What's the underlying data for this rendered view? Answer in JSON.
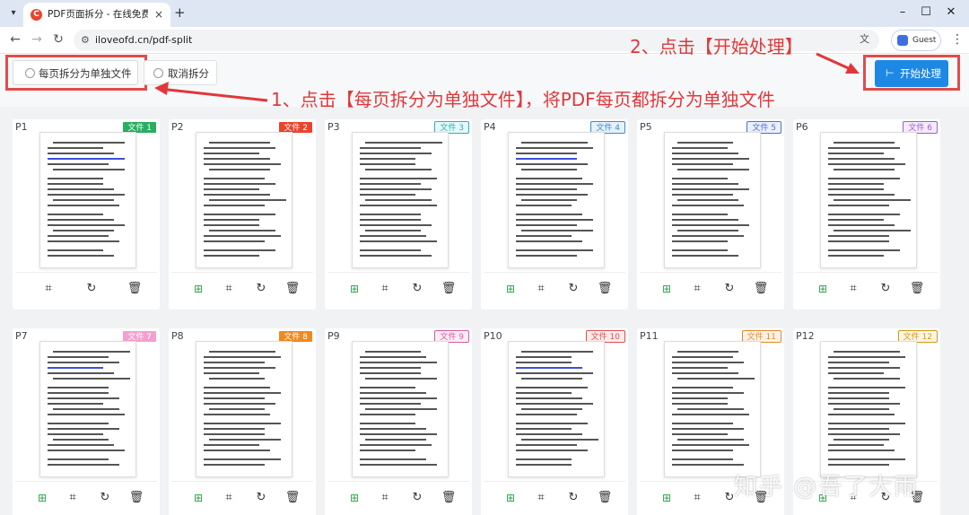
{
  "browser": {
    "tab_title": "PDF页面拆分 - 在线免费拆分PDF",
    "url": "iloveofd.cn/pdf-split",
    "profile_label": "Guest",
    "menu_glyph": "▾",
    "new_tab_glyph": "+",
    "close_glyph": "×"
  },
  "toolbar": {
    "each_page_label": "每页拆分为单独文件",
    "cancel_label": "取消拆分",
    "start_label": "开始处理"
  },
  "annotations": {
    "step1": "1、点击【每页拆分为单独文件】，将PDF每页都拆分为单独文件",
    "step2": "2、点击【开始处理】"
  },
  "pages": [
    {
      "label": "P1",
      "file": "文件 1",
      "badge_bg": "#27ae60",
      "badge_fg": "#ffffff"
    },
    {
      "label": "P2",
      "file": "文件 2",
      "badge_bg": "#e8442e",
      "badge_fg": "#ffffff"
    },
    {
      "label": "P3",
      "file": "文件 3",
      "badge_bg": "#e6f8f8",
      "badge_fg": "#2ab3b3"
    },
    {
      "label": "P4",
      "file": "文件 4",
      "badge_bg": "#e6f1fc",
      "badge_fg": "#3b8ad9"
    },
    {
      "label": "P5",
      "file": "文件 5",
      "badge_bg": "#eaf0fd",
      "badge_fg": "#4d6fe0"
    },
    {
      "label": "P6",
      "file": "文件 6",
      "badge_bg": "#f4ebfb",
      "badge_fg": "#a05cd6"
    },
    {
      "label": "P7",
      "file": "文件 7",
      "badge_bg": "#f59fd0",
      "badge_fg": "#ffffff"
    },
    {
      "label": "P8",
      "file": "文件 8",
      "badge_bg": "#f08a1c",
      "badge_fg": "#ffffff"
    },
    {
      "label": "P9",
      "file": "文件 9",
      "badge_bg": "#fdeef6",
      "badge_fg": "#d65aa0"
    },
    {
      "label": "P10",
      "file": "文件 10",
      "badge_bg": "#fdecec",
      "badge_fg": "#d85050"
    },
    {
      "label": "P11",
      "file": "文件 11",
      "badge_bg": "#fdf2e6",
      "badge_fg": "#e08a2a"
    },
    {
      "label": "P12",
      "file": "文件 12",
      "badge_bg": "#fdf6e3",
      "badge_fg": "#d49a1a"
    }
  ],
  "icons": {
    "split": "split-icon",
    "crop": "crop-icon",
    "rotate": "rotate-icon",
    "delete": "trash-icon"
  },
  "watermark": "知乎 @吾了大雨",
  "accent": "#1e88e5",
  "annotation_color": "#e0383a"
}
